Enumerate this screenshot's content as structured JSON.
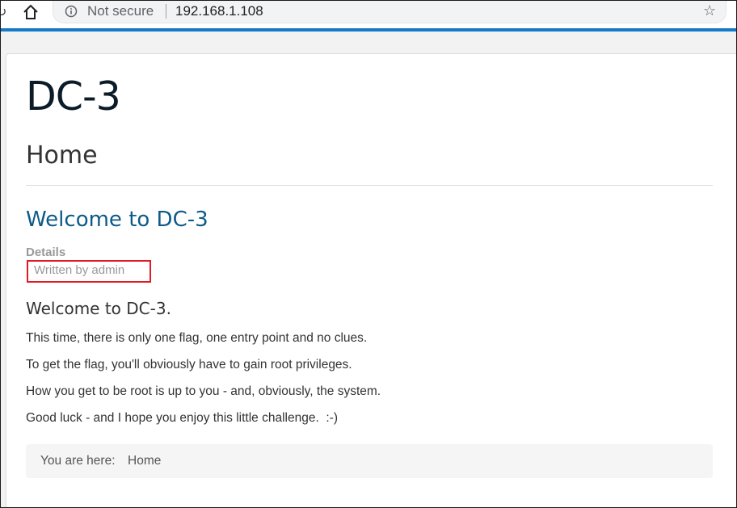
{
  "browser": {
    "security_label": "Not secure",
    "url": "192.168.1.108",
    "reload_glyph": "↻",
    "star_glyph": "☆",
    "icons": [
      "reload-icon",
      "home-icon",
      "info-icon",
      "star-icon"
    ],
    "accent_color": "#1479c7"
  },
  "site": {
    "title": "DC-3"
  },
  "page": {
    "heading": "Home"
  },
  "article": {
    "title": "Welcome to DC-3",
    "details_label": "Details",
    "author": "Written by admin",
    "subheading": "Welcome to DC-3.",
    "paragraphs": [
      "This time, there is only one flag, one entry point and no clues.",
      "To get the flag, you'll obviously have to gain root privileges.",
      "How you get to be root is up to you - and, obviously, the system.",
      "Good luck - and I hope you enjoy this little challenge.  :-)"
    ]
  },
  "breadcrumb": {
    "label": "You are here:",
    "current": "Home"
  },
  "colors": {
    "title_color": "#0b1c28",
    "link_color": "#0d5a8a",
    "highlight_box": "#e01b24"
  }
}
